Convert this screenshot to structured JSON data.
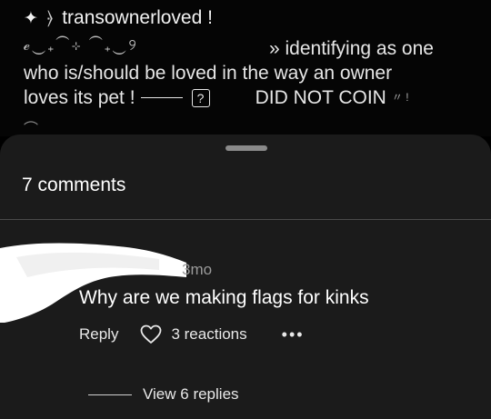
{
  "post": {
    "star_icon": "✦",
    "deco_icon": "⦒",
    "username": "transownerloved !",
    "deco_line": "ℯ‿₊⁀⊹ ⁀₊‿୨",
    "line1": "» identifying as one",
    "line2": "who is/should be loved in the way an owner",
    "line3_a": "loves its pet !",
    "line3_qbox": "?",
    "line3_b": "DID NOT COIN",
    "line3_tail": "〃 !",
    "bottom_deco": "⌒"
  },
  "sheet": {
    "comments_count": "7 comments",
    "comment": {
      "time": "3mo",
      "text": "Why are we making flags for kinks",
      "reply_label": "Reply",
      "reactions_label": "3 reactions",
      "more_label": "•••",
      "view_replies_label": "View 6 replies"
    }
  }
}
